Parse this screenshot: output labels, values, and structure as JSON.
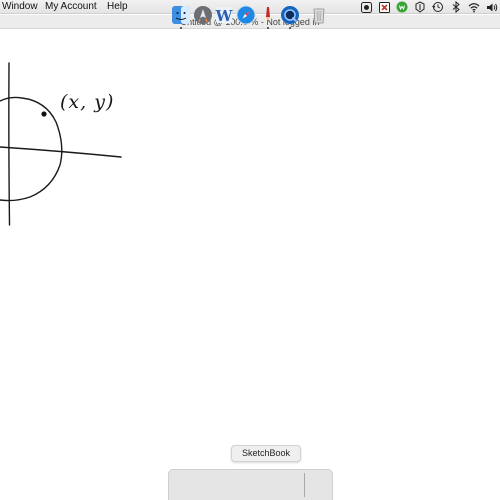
{
  "menubar": {
    "items": [
      "Window",
      "My Account",
      "Help"
    ],
    "tray_icons": [
      "record-icon",
      "close-box-icon",
      "evernote-icon",
      "wunderlist-icon",
      "time-machine-icon",
      "bluetooth-icon",
      "wifi-icon",
      "volume-icon"
    ]
  },
  "window": {
    "title": "Untitled @ 100.0 % - Not logged in"
  },
  "drawing": {
    "label": "(x, y)"
  },
  "dock": {
    "tooltip": "SketchBook",
    "apps": [
      "finder-icon",
      "launchpad-icon",
      "word-icon",
      "safari-icon",
      "sketchbook-icon",
      "quicktime-icon",
      "trash-icon"
    ]
  }
}
